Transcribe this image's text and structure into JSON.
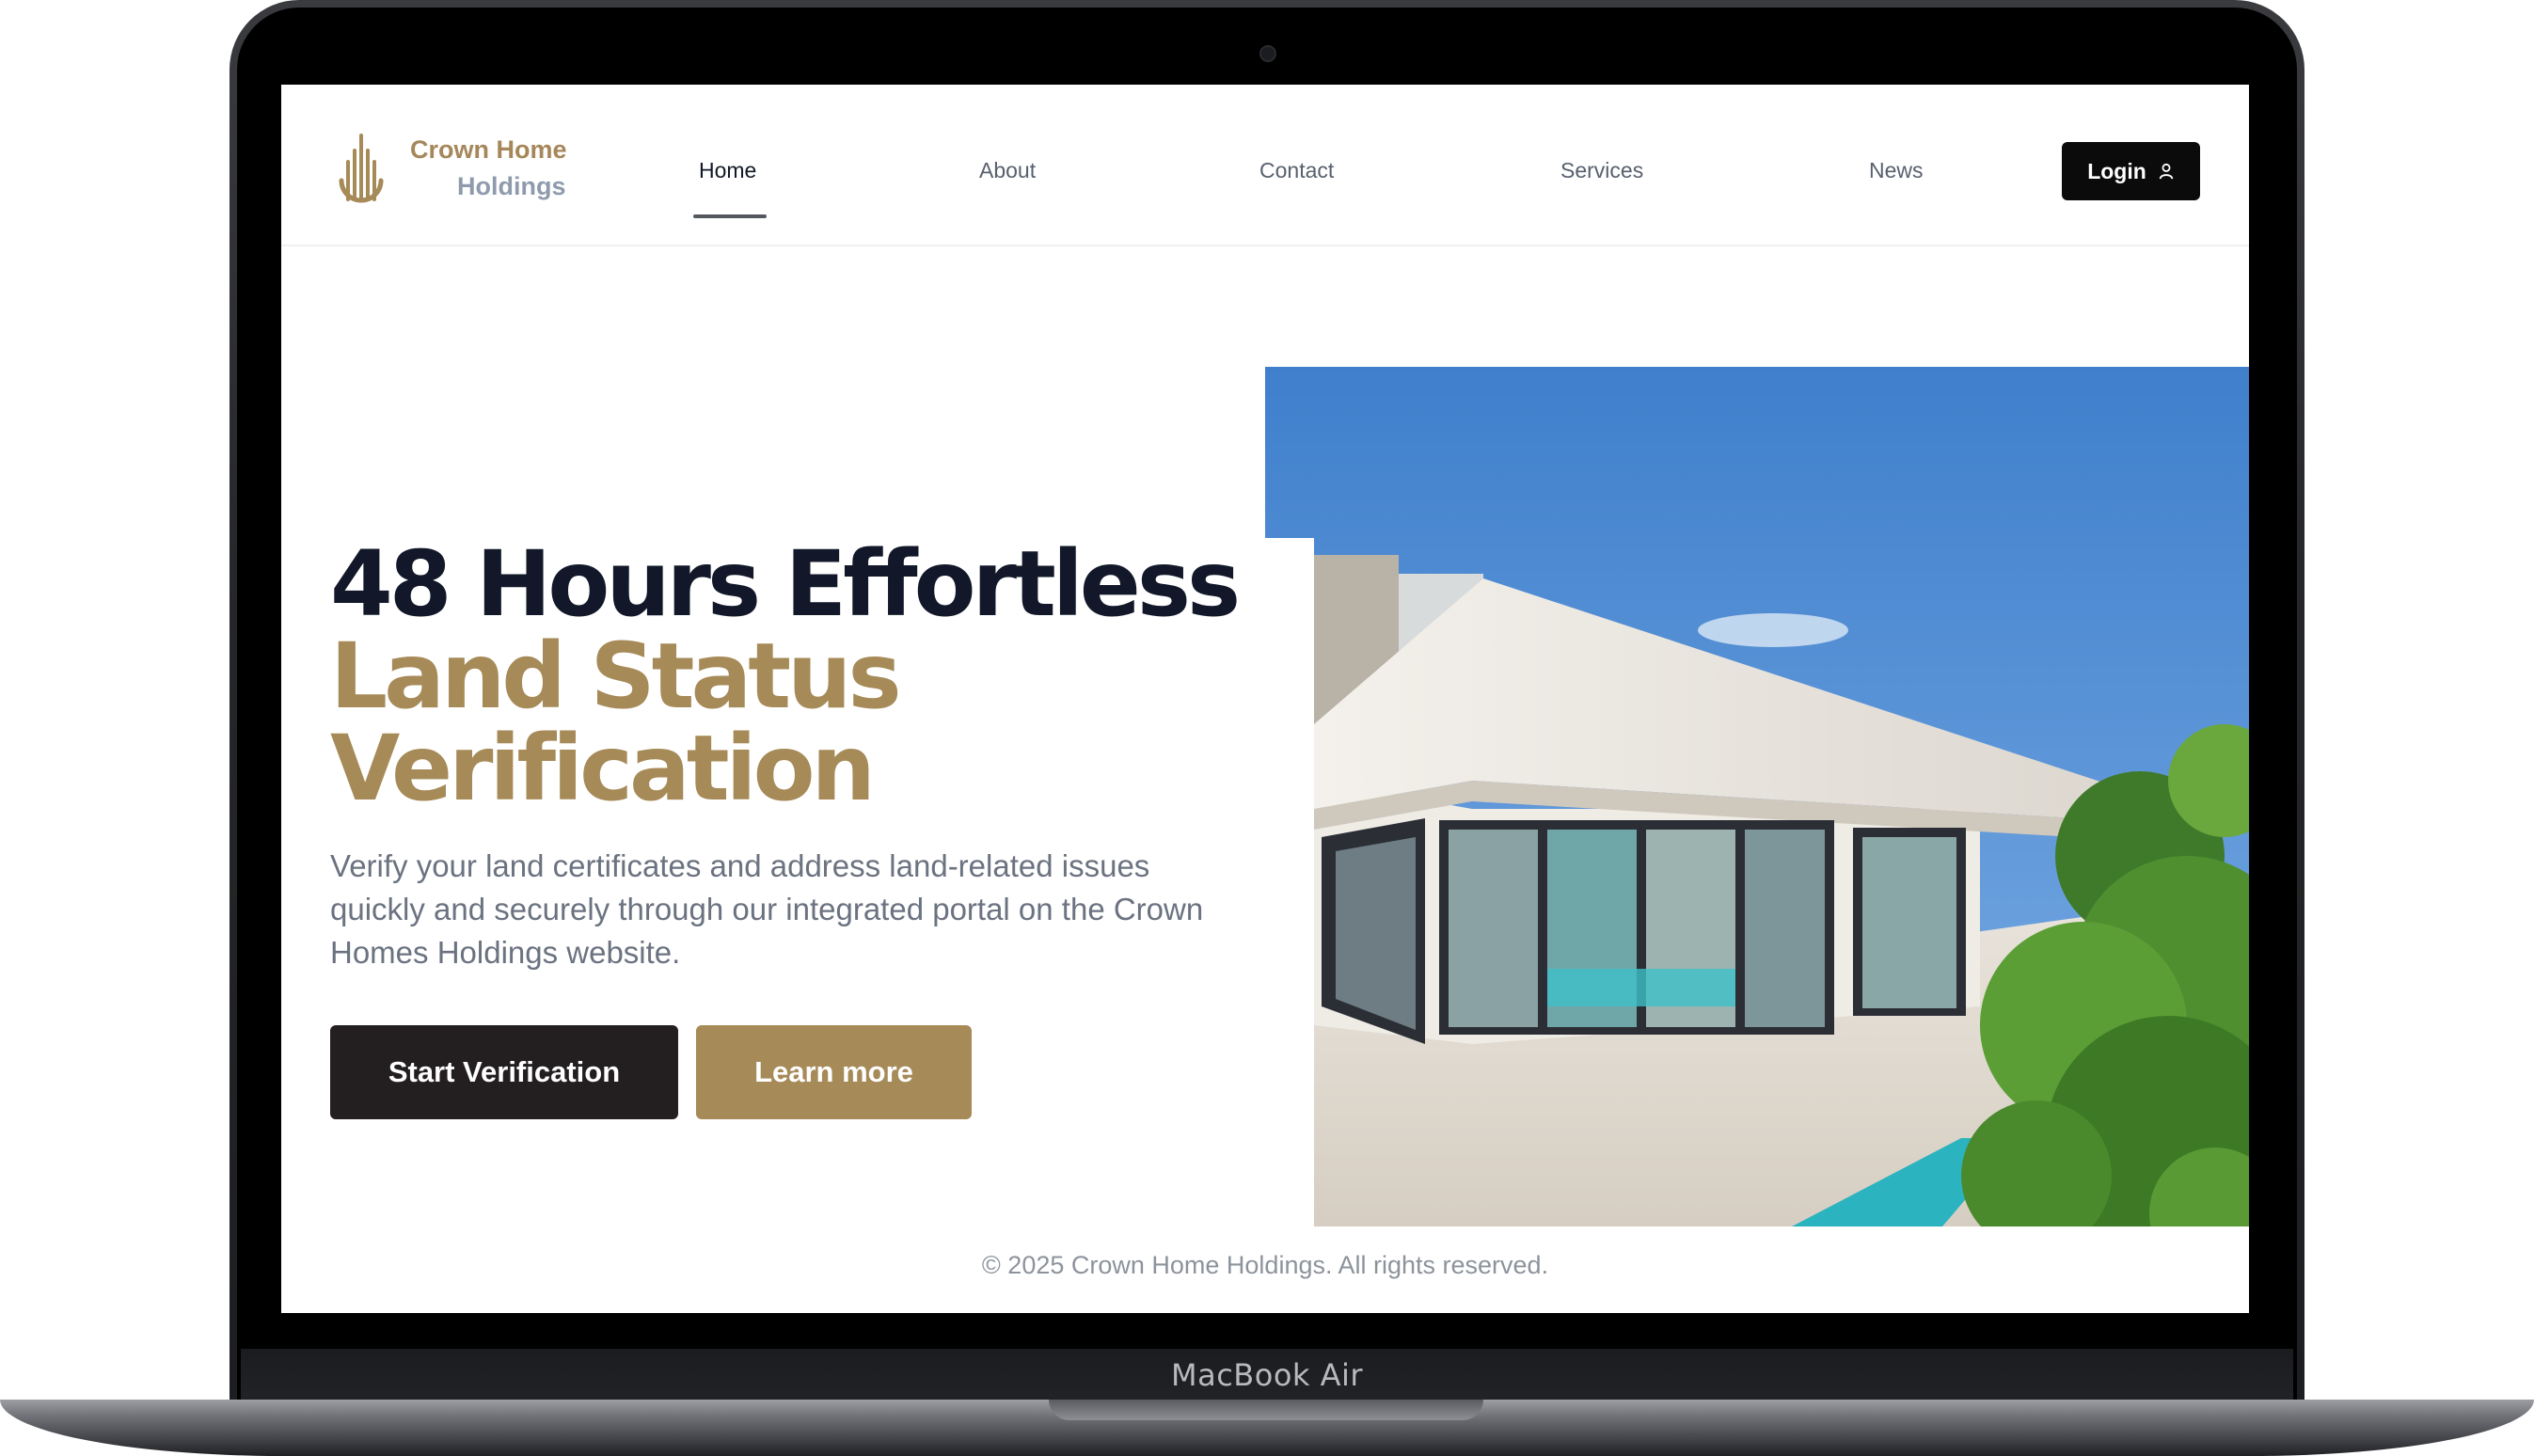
{
  "device": {
    "model_label": "MacBook Air"
  },
  "brand": {
    "name_line1": "Crown Home",
    "name_line2": "Holdings",
    "colors": {
      "gold": "#a68a58",
      "slate": "#8f9bac",
      "dark": "#121829"
    }
  },
  "nav": {
    "items": [
      {
        "label": "Home",
        "active": true
      },
      {
        "label": "About",
        "active": false
      },
      {
        "label": "Contact",
        "active": false
      },
      {
        "label": "Services",
        "active": false
      },
      {
        "label": "News",
        "active": false
      }
    ],
    "login_label": "Login",
    "login_icon": "user-icon"
  },
  "hero": {
    "headline_line1": "48 Hours Effortless",
    "headline_line2": "Land Status",
    "headline_line3": "Verification",
    "description": "Verify your land certificates and address land-related issues quickly and securely through our integrated portal on the Crown Homes Holdings website.",
    "primary_cta": "Start Verification",
    "secondary_cta": "Learn more",
    "image_subject": "modern white villa with glass doors, pool and plants"
  },
  "footer": {
    "copyright": "© 2025 Crown Home Holdings. All rights reserved."
  }
}
